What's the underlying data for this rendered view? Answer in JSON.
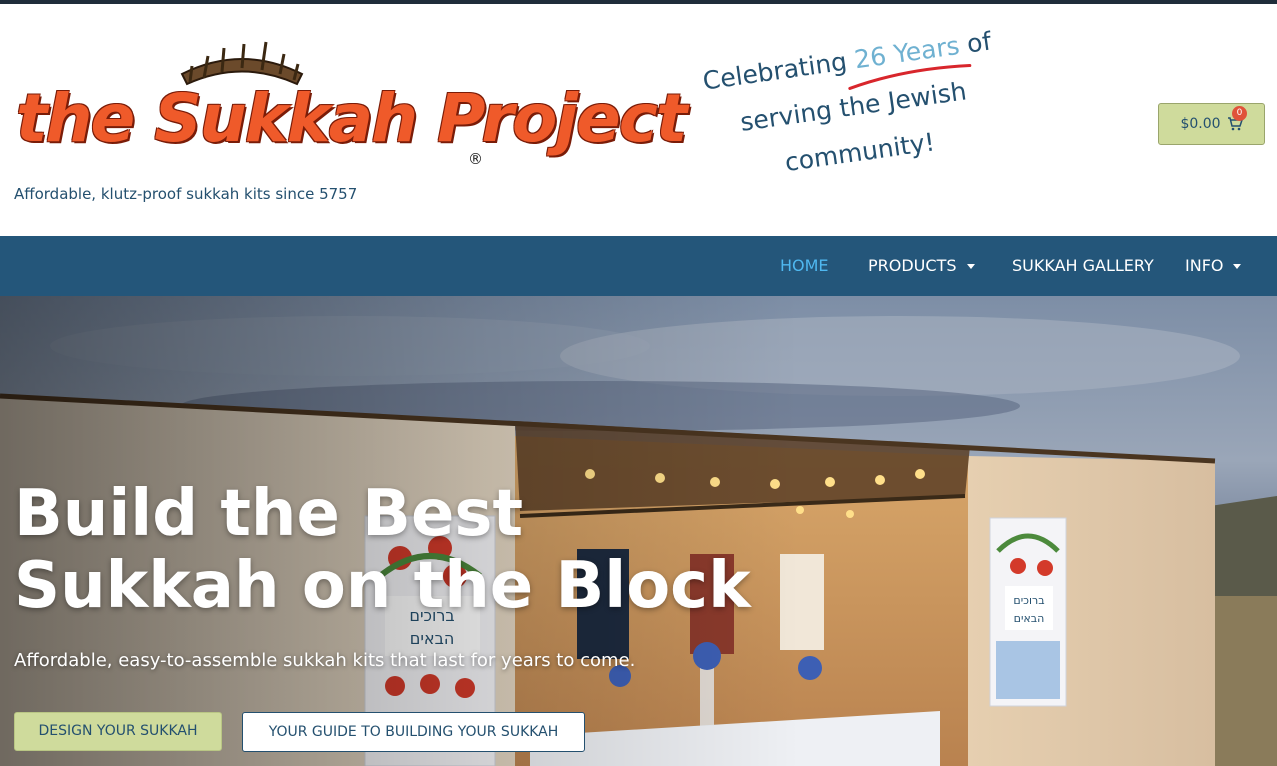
{
  "header": {
    "logo_text": "the Sukkah Project",
    "logo_registered": "®",
    "tagline": "Affordable, klutz-proof sukkah kits since 5757",
    "celebrate_line1_a": "Celebrating",
    "celebrate_years": "26 Years",
    "celebrate_line1_b": "of",
    "celebrate_line2": "serving the Jewish",
    "celebrate_line3": "community!"
  },
  "cart": {
    "total": "$0.00",
    "count": "0",
    "icon": "cart-icon"
  },
  "nav": {
    "items": [
      {
        "label": "HOME",
        "active": true,
        "dropdown": false
      },
      {
        "label": "PRODUCTS",
        "active": false,
        "dropdown": true
      },
      {
        "label": "SUKKAH GALLERY",
        "active": false,
        "dropdown": false
      },
      {
        "label": "INFO",
        "active": false,
        "dropdown": true
      }
    ]
  },
  "hero": {
    "title": "Build the Best Sukkah on the Block",
    "subtitle": "Affordable, easy-to-assemble sukkah kits that last for years to come.",
    "primary_button": "DESIGN YOUR SUKKAH",
    "secondary_button": "YOUR GUIDE TO BUILDING YOUR SUKKAH",
    "banner_text_line1": "ברוכים",
    "banner_text_line2": "הבאים"
  },
  "colors": {
    "brand_blue": "#24567a",
    "text_blue": "#24506f",
    "active_blue": "#4fb8f0",
    "button_green": "#cfdb9c",
    "logo_orange": "#ef5a2a",
    "accent_red": "#d8262c"
  }
}
